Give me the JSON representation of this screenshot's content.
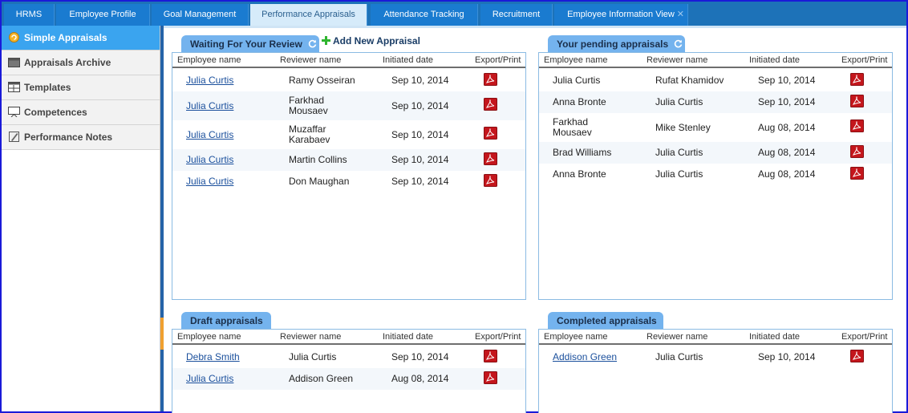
{
  "tabs": [
    {
      "label": "HRMS",
      "active": false
    },
    {
      "label": "Employee Profile",
      "active": false
    },
    {
      "label": "Goal Management",
      "active": false
    },
    {
      "label": "Performance Appraisals",
      "active": true
    },
    {
      "label": "Attendance Tracking",
      "active": false
    },
    {
      "label": "Recruitment",
      "active": false
    },
    {
      "label": "Employee Information View",
      "active": false
    }
  ],
  "sidebar": {
    "items": [
      {
        "label": "Simple Appraisals",
        "icon": "appraisal-icon",
        "active": true
      },
      {
        "label": "Appraisals Archive",
        "icon": "archive-icon",
        "active": false
      },
      {
        "label": "Templates",
        "icon": "templates-icon",
        "active": false
      },
      {
        "label": "Competences",
        "icon": "competences-icon",
        "active": false
      },
      {
        "label": "Performance Notes",
        "icon": "notes-icon",
        "active": false
      }
    ]
  },
  "columns": {
    "employee": "Employee name",
    "reviewer": "Reviewer name",
    "date": "Initiated date",
    "export": "Export/Print"
  },
  "add_new": "Add New Appraisal",
  "panels": {
    "waiting": {
      "title": "Waiting For Your Review",
      "rows": [
        {
          "employee": "Julia Curtis",
          "reviewer": "Ramy Osseiran",
          "date": "Sep 10, 2014"
        },
        {
          "employee": "Julia Curtis",
          "reviewer": "Farkhad\nMousaev",
          "date": "Sep 10, 2014"
        },
        {
          "employee": "Julia Curtis",
          "reviewer": "Muzaffar\nKarabaev",
          "date": "Sep 10, 2014"
        },
        {
          "employee": "Julia Curtis",
          "reviewer": "Martin Collins",
          "date": "Sep 10, 2014"
        },
        {
          "employee": "Julia Curtis",
          "reviewer": "Don Maughan",
          "date": "Sep 10, 2014"
        }
      ]
    },
    "pending": {
      "title": "Your pending appraisals",
      "rows": [
        {
          "employee": "Julia Curtis",
          "reviewer": "Rufat Khamidov",
          "date": "Sep 10, 2014"
        },
        {
          "employee": "Anna Bronte",
          "reviewer": "Julia Curtis",
          "date": "Sep 10, 2014"
        },
        {
          "employee": "Farkhad\nMousaev",
          "reviewer": "Mike Stenley",
          "date": "Aug 08, 2014"
        },
        {
          "employee": "Brad Williams",
          "reviewer": "Julia Curtis",
          "date": "Aug 08, 2014"
        },
        {
          "employee": "Anna Bronte",
          "reviewer": "Julia Curtis",
          "date": "Aug 08, 2014"
        }
      ]
    },
    "draft": {
      "title": "Draft appraisals",
      "rows": [
        {
          "employee": "Debra Smith",
          "reviewer": "Julia Curtis",
          "date": "Sep 10, 2014"
        },
        {
          "employee": "Julia Curtis",
          "reviewer": "Addison Green",
          "date": "Aug 08, 2014"
        }
      ]
    },
    "completed": {
      "title": "Completed appraisals",
      "rows": [
        {
          "employee": "Addison Green",
          "reviewer": "Julia Curtis",
          "date": "Sep 10, 2014"
        }
      ]
    }
  },
  "colors": {
    "accent": "#3aa4ef",
    "tab_bar": "#1d72b8",
    "panel_tab": "#74b3ee",
    "link": "#1a4f9c",
    "pdf": "#c4161c"
  }
}
